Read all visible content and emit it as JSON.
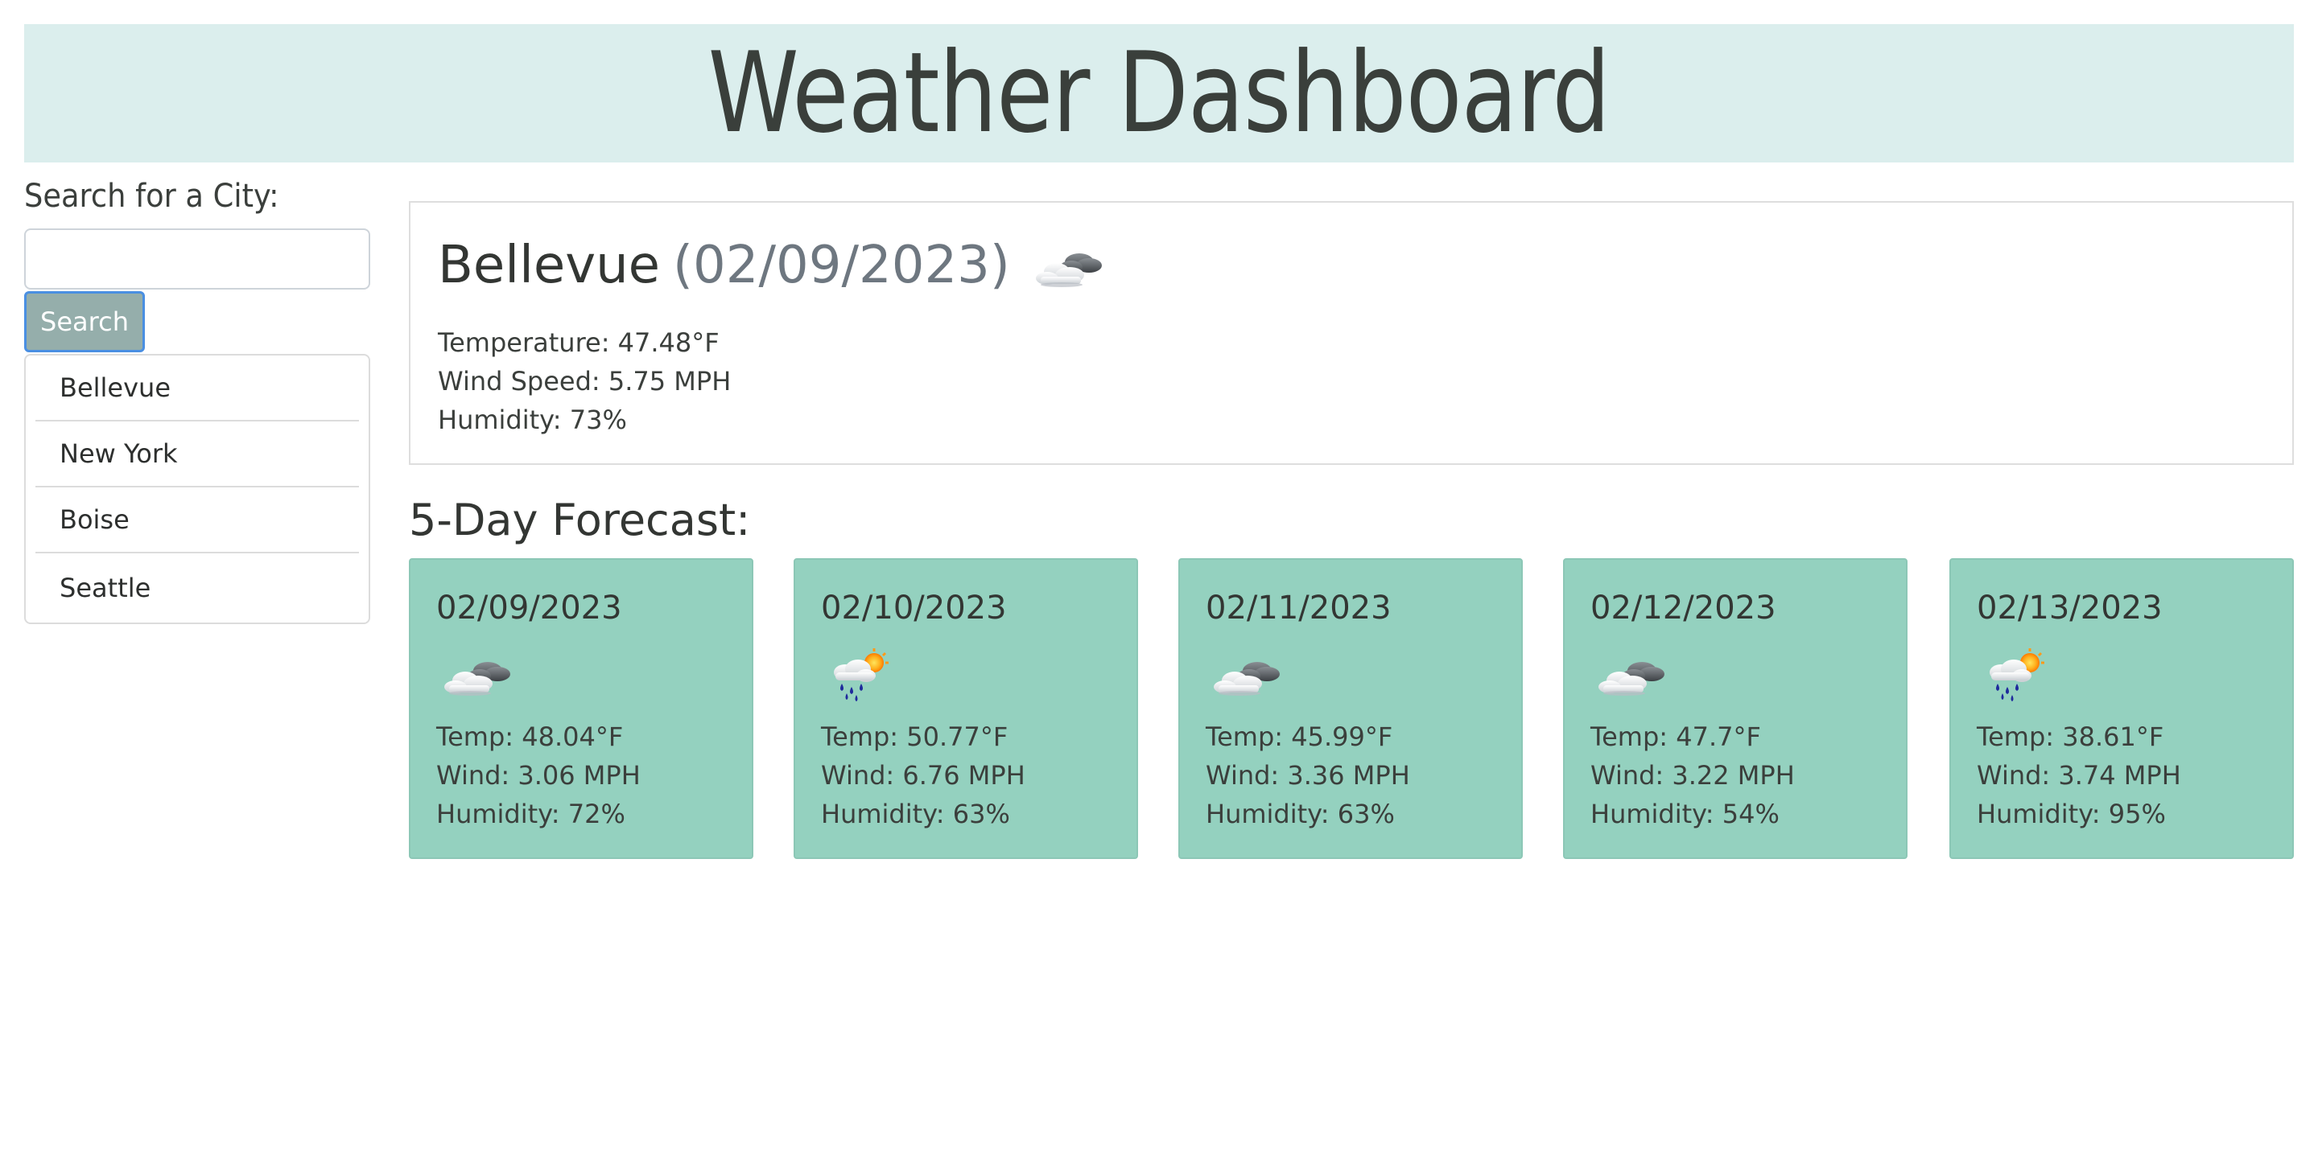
{
  "header": {
    "title": "Weather Dashboard"
  },
  "sidebar": {
    "search_label": "Search for a City:",
    "search_input_value": "",
    "search_input_placeholder": "",
    "search_button_label": "Search",
    "cities": [
      "Bellevue",
      "New York",
      "Boise",
      "Seattle"
    ]
  },
  "current": {
    "city": "Bellevue",
    "date": "(02/09/2023)",
    "icon": "cloudy-icon",
    "temperature": "Temperature: 47.48°F",
    "wind": "Wind Speed: 5.75 MPH",
    "humidity": "Humidity: 73%"
  },
  "forecast": {
    "heading": "5-Day Forecast:",
    "days": [
      {
        "date": "02/09/2023",
        "icon": "cloudy-icon",
        "temp": "Temp: 48.04°F",
        "wind": "Wind: 3.06 MPH",
        "humidity": "Humidity: 72%"
      },
      {
        "date": "02/10/2023",
        "icon": "rain-sun-icon",
        "temp": "Temp: 50.77°F",
        "wind": "Wind: 6.76 MPH",
        "humidity": "Humidity: 63%"
      },
      {
        "date": "02/11/2023",
        "icon": "cloudy-icon",
        "temp": "Temp: 45.99°F",
        "wind": "Wind: 3.36 MPH",
        "humidity": "Humidity: 63%"
      },
      {
        "date": "02/12/2023",
        "icon": "cloudy-icon",
        "temp": "Temp: 47.7°F",
        "wind": "Wind: 3.22 MPH",
        "humidity": "Humidity: 54%"
      },
      {
        "date": "02/13/2023",
        "icon": "rain-sun-icon",
        "temp": "Temp: 38.61°F",
        "wind": "Wind: 3.74 MPH",
        "humidity": "Humidity: 95%"
      }
    ]
  },
  "colors": {
    "header_bg": "#dbeeed",
    "card_bg": "#94d1bf",
    "button_bg": "#95aeab",
    "button_border": "#4a8fe2"
  }
}
